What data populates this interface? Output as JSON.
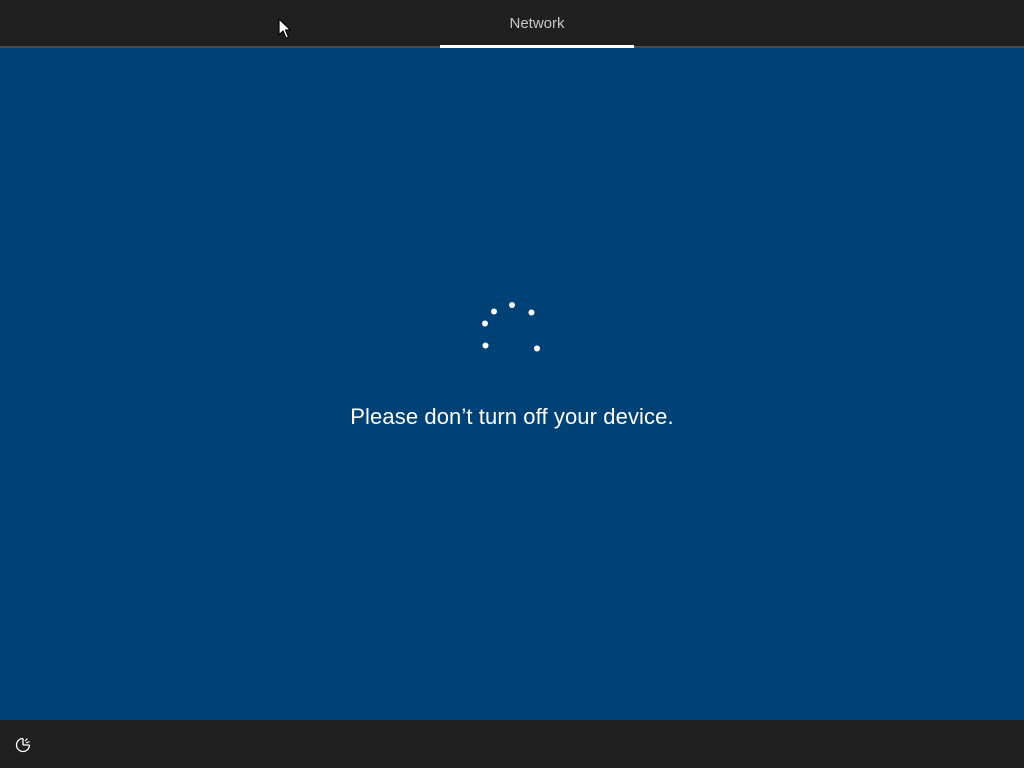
{
  "header": {
    "active_tab_label": "Network"
  },
  "main": {
    "status_message": "Please don’t turn off your device.",
    "spinner_icon": "loading-spinner-icon"
  },
  "footer": {
    "ease_of_access_icon": "ease-of-access-icon"
  },
  "colors": {
    "background": "#004275",
    "bar": "#1f1f1f",
    "text": "#ffffff",
    "tab_text": "#c8c8c8"
  }
}
